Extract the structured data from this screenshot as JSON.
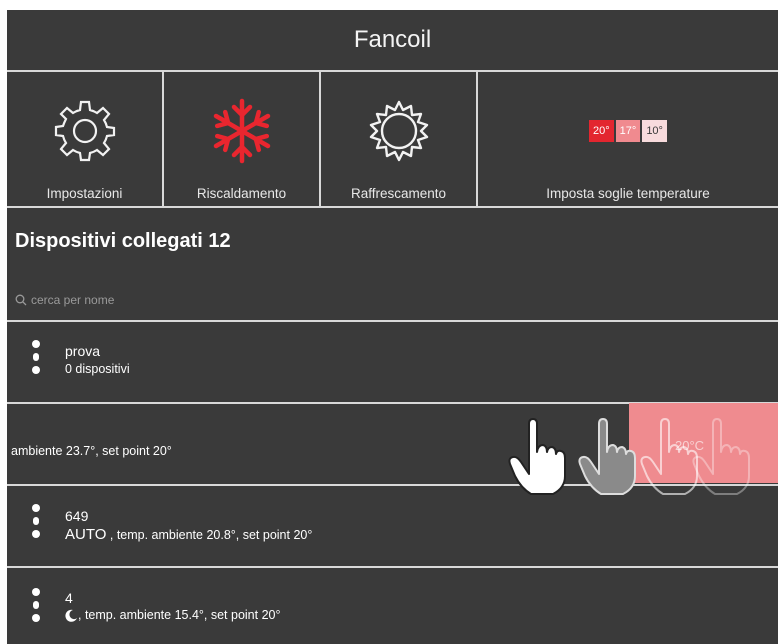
{
  "header": {
    "title": "Fancoil"
  },
  "tiles": [
    {
      "label": "Impostazioni",
      "icon": "gear-icon"
    },
    {
      "label": "Riscaldamento",
      "icon": "snowflake-icon",
      "color": "#e9262f"
    },
    {
      "label": "Raffrescamento",
      "icon": "sun-icon"
    },
    {
      "label": "Imposta soglie temperature",
      "icon": "temperature-chips",
      "chips": [
        {
          "text": "20°",
          "bg": "#e3262f",
          "fg": "#ffffff"
        },
        {
          "text": "17°",
          "bg": "#f08a8f",
          "fg": "#ffffff"
        },
        {
          "text": "10°",
          "bg": "#f8dbdd",
          "fg": "#3a3a3a"
        }
      ]
    }
  ],
  "devices": {
    "title": "Dispositivi collegati 12",
    "search_placeholder": "cerca per nome",
    "rows": [
      {
        "name": "prova",
        "detail": "0 dispositivi"
      },
      {
        "detail": "ambiente 23.7°, set point 20°",
        "swipe_label": "20°C"
      },
      {
        "name": "649",
        "mode": "AUTO",
        "detail": " , temp. ambiente 20.8°, set point 20°"
      },
      {
        "name": "4",
        "mode_icon": "moon-icon",
        "detail": ", temp. ambiente 15.4°, set point 20°"
      }
    ]
  },
  "colors": {
    "background": "#3a3a3a",
    "divider": "#d8d8d8",
    "accent_red": "#e9262f",
    "swipe_red": "#ef8b8f"
  }
}
